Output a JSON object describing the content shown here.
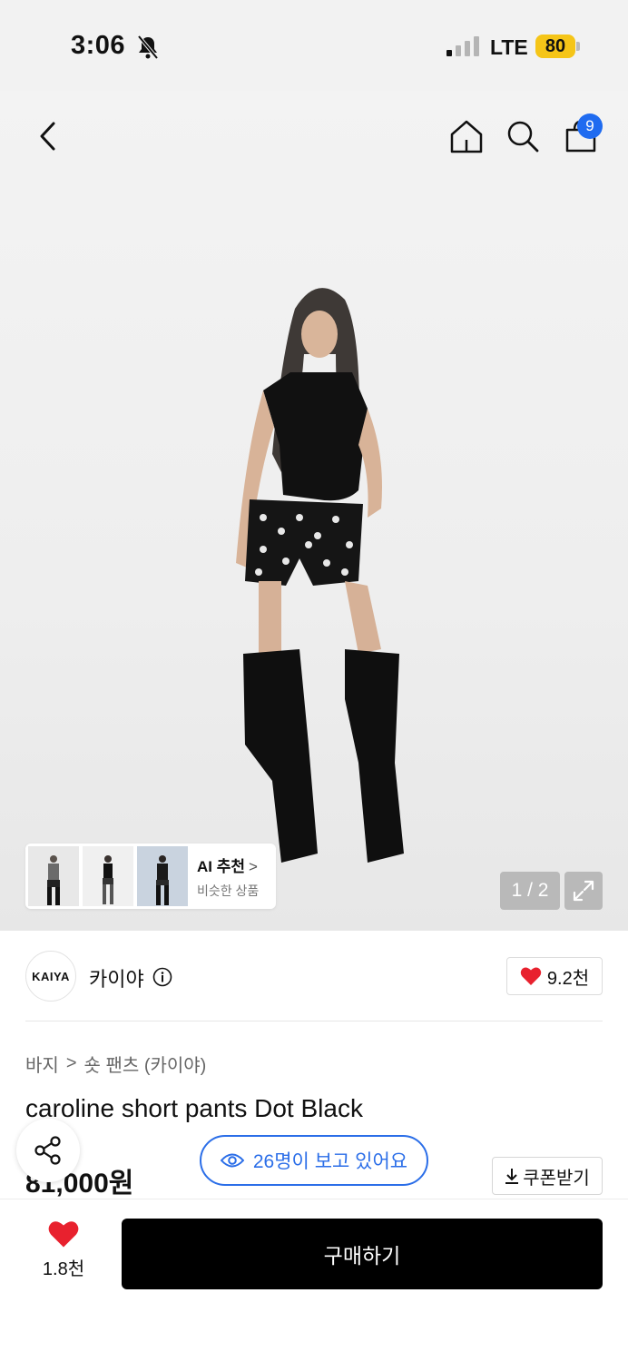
{
  "status_bar": {
    "time": "3:06",
    "network": "LTE",
    "battery": "80"
  },
  "header": {
    "cart_count": "9"
  },
  "gallery": {
    "pager": "1 / 2"
  },
  "ai_recommend": {
    "title": "AI 추천",
    "chevron": ">",
    "subtitle": "비슷한 상품"
  },
  "brand": {
    "logo_text": "KAIYA",
    "name": "카이야",
    "likes": "9.2천"
  },
  "breadcrumb": {
    "category": "바지",
    "separator": ">",
    "subcategory": "숏 팬츠 (카이야)"
  },
  "product": {
    "title": "caroline short pants Dot Black",
    "price": "81,000원"
  },
  "viewers": {
    "text": "26명이 보고 있어요"
  },
  "coupon": {
    "label": "쿠폰받기"
  },
  "bottom": {
    "wish_count": "1.8천",
    "buy_label": "구매하기"
  },
  "colors": {
    "accent_blue": "#2b6ee8",
    "heart_red": "#e8212e",
    "battery_yellow": "#f5c518"
  }
}
